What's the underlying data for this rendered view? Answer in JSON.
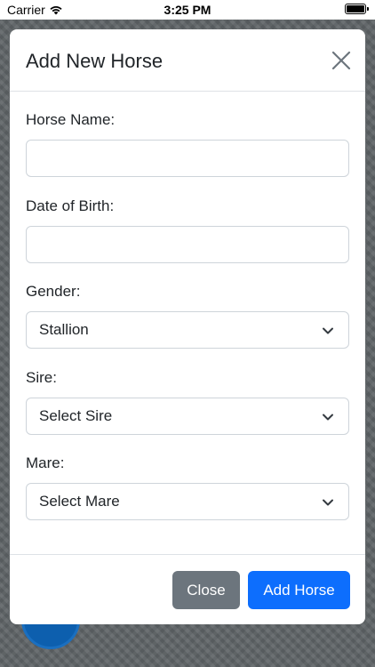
{
  "status_bar": {
    "carrier": "Carrier",
    "time": "3:25 PM",
    "wifi_icon": "wifi-icon",
    "battery_icon": "battery-icon"
  },
  "modal": {
    "title": "Add New Horse",
    "close_icon": "close-icon",
    "fields": {
      "horse_name": {
        "label": "Horse Name:",
        "value": "",
        "placeholder": ""
      },
      "date_of_birth": {
        "label": "Date of Birth:",
        "value": "",
        "placeholder": ""
      },
      "gender": {
        "label": "Gender:",
        "selected": "Stallion"
      },
      "sire": {
        "label": "Sire:",
        "selected": "Select Sire"
      },
      "mare": {
        "label": "Mare:",
        "selected": "Select Mare"
      }
    },
    "footer": {
      "close_label": "Close",
      "add_label": "Add Horse"
    }
  },
  "colors": {
    "primary": "#0d6efd",
    "secondary": "#6c757d",
    "backdrop": "#5f6467"
  }
}
